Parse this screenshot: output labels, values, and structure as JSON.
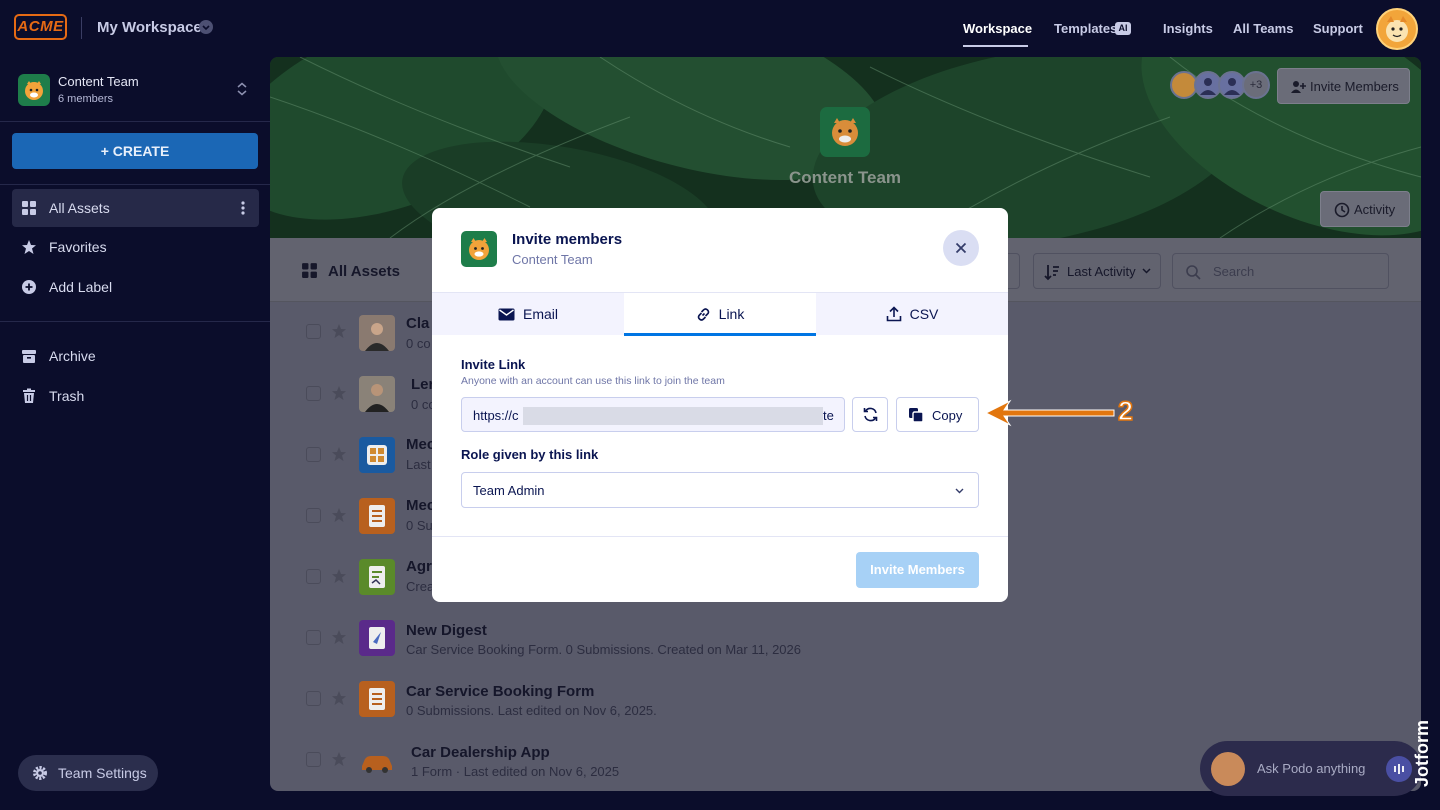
{
  "header": {
    "logo_text": "ACME",
    "workspace_title": "My Workspace",
    "nav": [
      {
        "label": "Workspace",
        "active": true
      },
      {
        "label": "Templates",
        "badge": "AI"
      },
      {
        "label": "Insights"
      },
      {
        "label": "All Teams"
      },
      {
        "label": "Support"
      }
    ]
  },
  "sidebar": {
    "team_name": "Content Team",
    "team_members": "6 members",
    "create_label": "+ CREATE",
    "items": [
      {
        "label": "All Assets",
        "icon": "grid-icon",
        "active": true
      },
      {
        "label": "Favorites",
        "icon": "star-icon"
      },
      {
        "label": "Add Label",
        "icon": "plus-circle-icon"
      },
      {
        "label": "Archive",
        "icon": "archive-icon"
      },
      {
        "label": "Trash",
        "icon": "trash-icon"
      }
    ],
    "team_settings_label": "Team Settings"
  },
  "banner": {
    "team_title": "Content Team",
    "avatars_more": "+3",
    "invite_label": "Invite Members",
    "activity_label": "Activity"
  },
  "toolbar": {
    "title": "All Assets",
    "sort_label": "Last Activity",
    "search_placeholder": "Search"
  },
  "assets": [
    {
      "title": "Cla",
      "sub": "0 co"
    },
    {
      "title": "Ler",
      "sub": "0 co"
    },
    {
      "title": "Mec",
      "sub": "Last"
    },
    {
      "title": "Mec",
      "sub": "0 Su"
    },
    {
      "title": "Agr",
      "sub": "Crea"
    },
    {
      "title": "New Digest",
      "sub": "Car Service Booking Form. 0 Submissions. Created on Mar 11, 2026"
    },
    {
      "title": "Car Service Booking Form",
      "sub": "0 Submissions.  Last edited on Nov 6, 2025."
    },
    {
      "title": "Car Dealership App",
      "sub": "1 Form · Last edited on Nov 6, 2025"
    }
  ],
  "podo": {
    "label": "Ask Podo anything"
  },
  "modal": {
    "title": "Invite members",
    "subtitle": "Content Team",
    "tabs": [
      {
        "label": "Email",
        "icon": "envelope-icon"
      },
      {
        "label": "Link",
        "icon": "link-icon",
        "active": true
      },
      {
        "label": "CSV",
        "icon": "upload-icon"
      }
    ],
    "invite_link_label": "Invite Link",
    "invite_link_help": "Anyone with an account can use this link to join the team",
    "link_prefix": "https://c",
    "link_suffix": "te",
    "copy_label": "Copy",
    "role_label": "Role given by this link",
    "role_value": "Team Admin",
    "submit_label": "Invite Members"
  },
  "annotation": {
    "step": "2"
  },
  "colors": {
    "accent": "#0075e3",
    "create": "#1b67b5",
    "annotation": "#e2760e",
    "modal_text": "#0a1551"
  }
}
